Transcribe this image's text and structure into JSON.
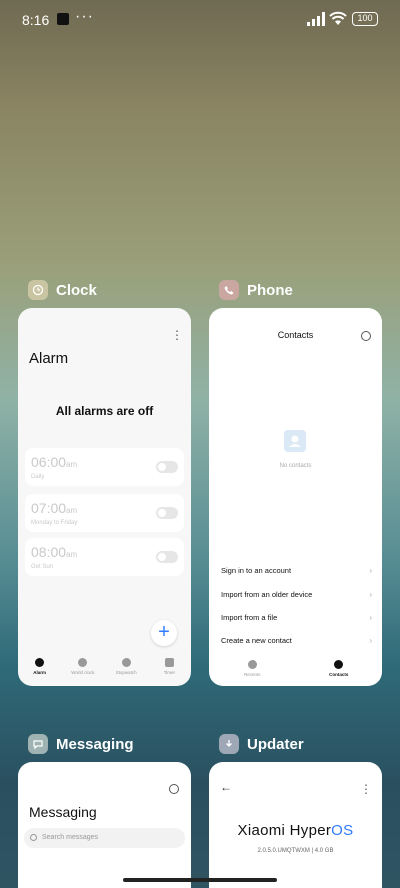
{
  "status_bar": {
    "time": "8:16",
    "dots": "···",
    "battery": "100"
  },
  "apps": {
    "clock": {
      "label": "Clock",
      "alarm_title": "Alarm",
      "empty_message": "All alarms are off",
      "alarms": [
        {
          "time": "06:00",
          "ampm": "am",
          "repeat": "Daily",
          "enabled": false
        },
        {
          "time": "07:00",
          "ampm": "am",
          "repeat": "Monday to Friday",
          "enabled": false
        },
        {
          "time": "08:00",
          "ampm": "am",
          "repeat": "Get Sun",
          "enabled": false
        }
      ],
      "nav": [
        "Alarm",
        "World clock",
        "Stopwatch",
        "Timer"
      ]
    },
    "phone": {
      "label": "Phone",
      "title": "Contacts",
      "empty_message": "No contacts",
      "options": [
        "Sign in to an account",
        "Import from an older device",
        "Import from a file",
        "Create a new contact"
      ],
      "nav": [
        "Recents",
        "Contacts"
      ]
    },
    "messaging": {
      "label": "Messaging",
      "title": "Messaging",
      "search_placeholder": "Search messages"
    },
    "updater": {
      "label": "Updater",
      "brand_prefix": "Xiaomi Hyper",
      "brand_suffix": "OS",
      "version": "2.0.5.0.UMQTWXM | 4.0 GB"
    }
  },
  "colors": {
    "accent": "#2f7bff"
  }
}
